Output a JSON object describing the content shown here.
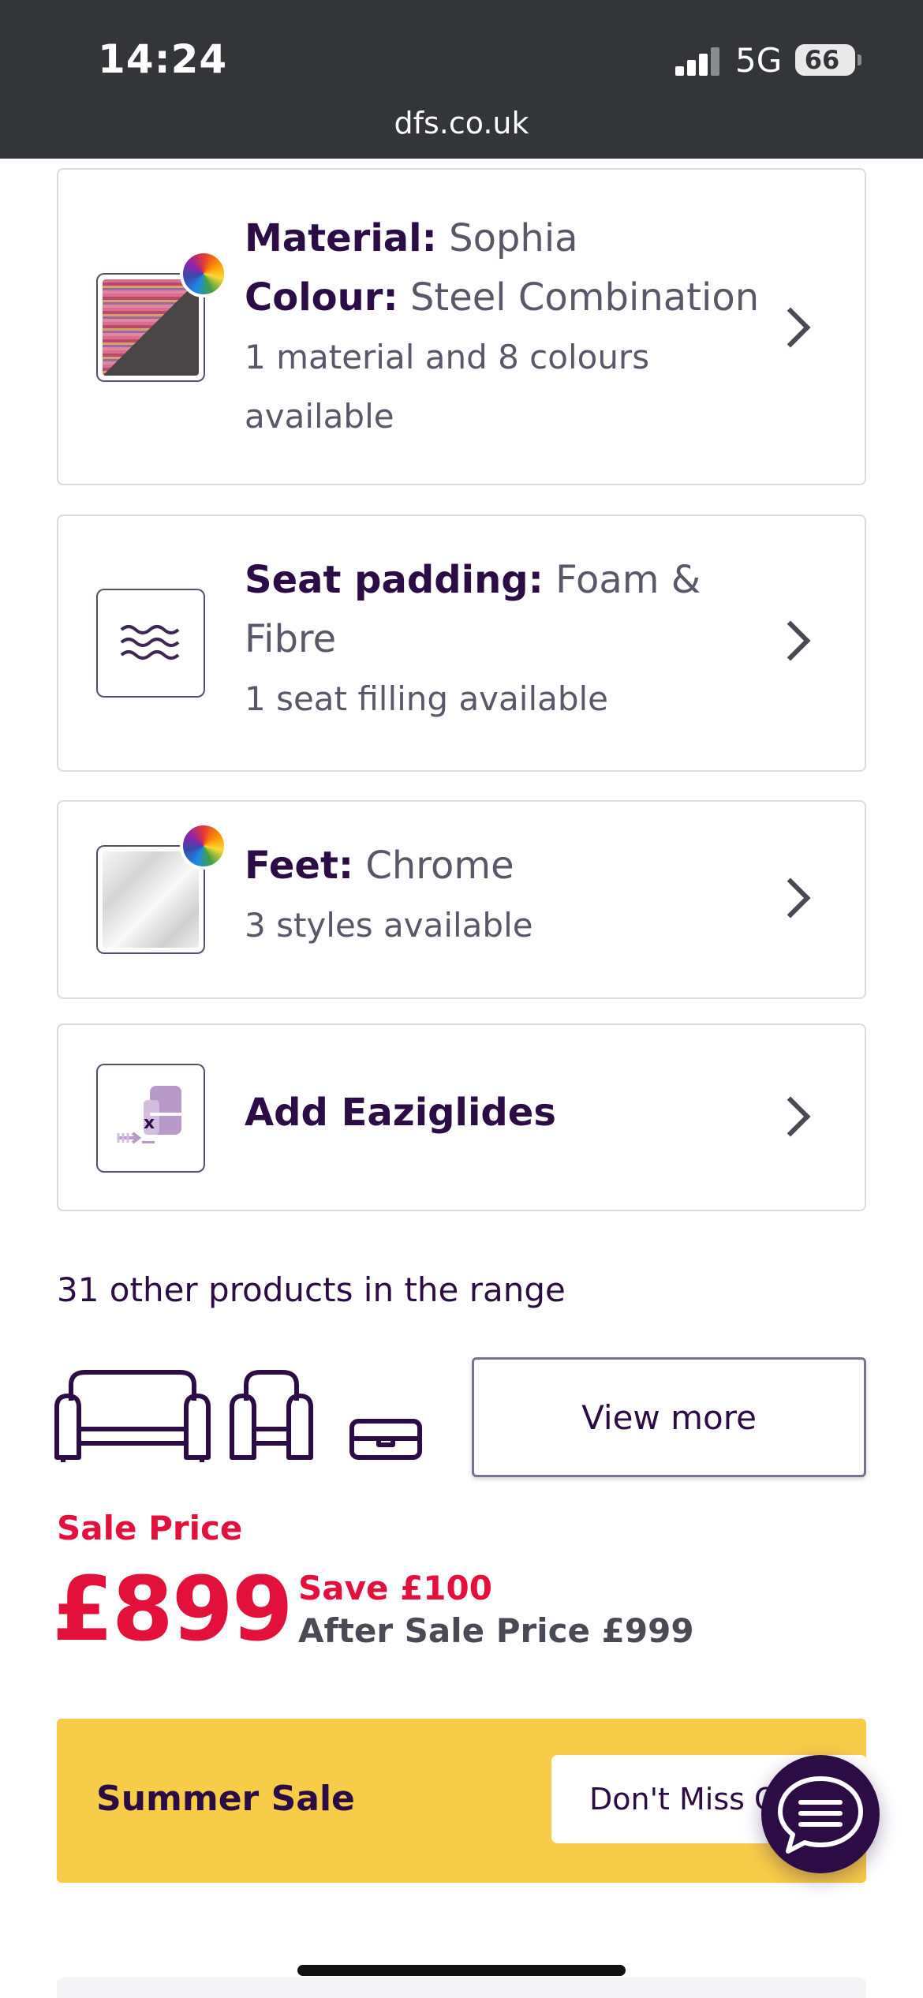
{
  "status_bar": {
    "time": "14:24",
    "network": "5G",
    "battery": "66"
  },
  "browser": {
    "url": "dfs.co.uk"
  },
  "options": [
    {
      "label": "Material:",
      "value": "Sophia",
      "label2": "Colour:",
      "value2": "Steel Combination",
      "sub": "1 material and 8 colours available",
      "icon": "fabric-swatch-icon"
    },
    {
      "label": "Seat padding:",
      "value": "Foam & Fibre",
      "sub": "1 seat filling available",
      "icon": "waves-icon"
    },
    {
      "label": "Feet:",
      "value": "Chrome",
      "sub": "3 styles available",
      "icon": "chrome-swatch-icon"
    },
    {
      "label": "Add Eaziglides",
      "icon": "eaziglides-icon"
    }
  ],
  "range": {
    "title": "31 other products in the range",
    "view_more": "View more",
    "icons": [
      "sofa-icon",
      "armchair-icon",
      "footstool-icon"
    ]
  },
  "price": {
    "sale_label": "Sale Price",
    "amount": "£899",
    "save": "Save £100",
    "after": "After Sale Price £999"
  },
  "banner": {
    "title": "Summer Sale",
    "button": "Don't Miss Out"
  },
  "colors": {
    "brand_purple": "#2b0c45",
    "sale_red": "#e3103b",
    "banner_yellow": "#f7cc49"
  }
}
